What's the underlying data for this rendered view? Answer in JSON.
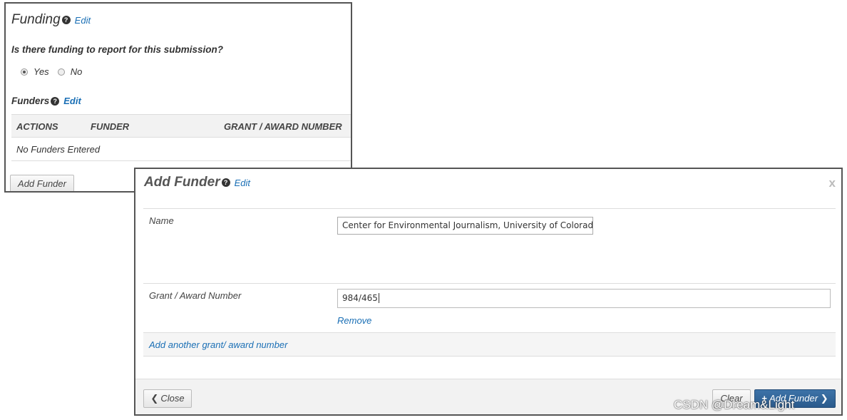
{
  "funding": {
    "title": "Funding",
    "help_icon": "question-circle-icon",
    "edit_label": "Edit",
    "question": "Is there funding to report for this submission?",
    "options": [
      {
        "label": "Yes",
        "checked": true
      },
      {
        "label": "No",
        "checked": false
      }
    ],
    "funders_title": "Funders",
    "funders_edit_label": "Edit",
    "table": {
      "columns": [
        "ACTIONS",
        "FUNDER",
        "GRANT / AWARD NUMBER"
      ],
      "empty_text": "No Funders Entered"
    },
    "add_button": "Add Funder"
  },
  "modal": {
    "title": "Add Funder",
    "edit_label": "Edit",
    "close_x": "x",
    "name_label": "Name",
    "name_value": "Center for Environmental Journalism, University of Colorado Bc",
    "grant_label": "Grant / Award Number",
    "grant_value": "984/465",
    "remove_label": "Remove",
    "add_another_label": "Add another grant/ award number",
    "close_button": "Close",
    "clear_button": "Clear",
    "add_button": "Add Funder"
  },
  "watermark": "CSDN @⁠⁠⁠Dream&Light⁠⁠⁠",
  "colors": {
    "link": "#1a6fb5",
    "primary_button": "#2f639a"
  }
}
